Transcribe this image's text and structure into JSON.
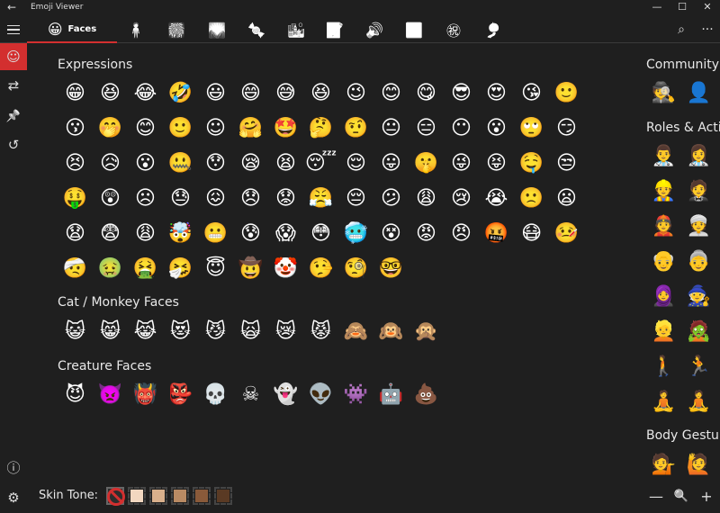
{
  "titlebar": {
    "back_icon": "←",
    "title": "Emoji Viewer",
    "minimize": "—",
    "maximize": "☐",
    "close": "✕"
  },
  "tabs": [
    {
      "name": "faces",
      "icon": "😀",
      "label": "Faces",
      "active": true
    },
    {
      "name": "people",
      "icon": "🧍",
      "label": ""
    },
    {
      "name": "activities",
      "icon": "🎆",
      "label": ""
    },
    {
      "name": "travel",
      "icon": "🌄",
      "label": ""
    },
    {
      "name": "food",
      "icon": "🍬",
      "label": ""
    },
    {
      "name": "places",
      "icon": "🏙",
      "label": ""
    },
    {
      "name": "objects",
      "icon": "📝",
      "label": ""
    },
    {
      "name": "sound",
      "icon": "🔊",
      "label": ""
    },
    {
      "name": "symbols",
      "icon": "🈺",
      "label": ""
    },
    {
      "name": "flags",
      "icon": "㊗",
      "label": ""
    },
    {
      "name": "misc",
      "icon": "🎐",
      "label": ""
    }
  ],
  "toolbar": {
    "search_icon": "⌕",
    "more_icon": "···"
  },
  "leftnav": {
    "menu": "☰",
    "smiley": "☺",
    "convert": "⇄",
    "pin": "📌",
    "history": "↺",
    "info": "ⓘ",
    "settings": "⚙"
  },
  "sections": {
    "expressions": {
      "title": "Expressions",
      "emojis": [
        "😁",
        "😆",
        "😂",
        "🤣",
        "😃",
        "😄",
        "😅",
        "😆",
        "😉",
        "😊",
        "😋",
        "😎",
        "😍",
        "😘",
        "🙂",
        "😗",
        "🤭",
        "😊",
        "🙂",
        "☺",
        "🤗",
        "🤩",
        "🤔",
        "🤨",
        "😐",
        "😑",
        "😶",
        "😮",
        "🙄",
        "😏",
        "😣",
        "😥",
        "😮",
        "🤐",
        "😯",
        "😪",
        "😫",
        "😴",
        "😌",
        "😛",
        "🤫",
        "😜",
        "😝",
        "🤤",
        "😒",
        "🤑",
        "😲",
        "☹",
        "😓",
        "😖",
        "😞",
        "😟",
        "😤",
        "😔",
        "😕",
        "😩",
        "😢",
        "😭",
        "🙁",
        "😦",
        "😧",
        "😨",
        "😩",
        "🤯",
        "😬",
        "😰",
        "😱",
        "😳",
        "🥶",
        "😵",
        "😡",
        "😠",
        "🤬",
        "😷",
        "🤒",
        "🤕",
        "🤢",
        "🤮",
        "🤧",
        "😇",
        "🤠",
        "🤡",
        "🤥",
        "🧐",
        "🤓"
      ]
    },
    "cats": {
      "title": "Cat / Monkey Faces",
      "emojis": [
        "😺",
        "😸",
        "😹",
        "😻",
        "😼",
        "🙀",
        "😿",
        "😾",
        "🙈",
        "🙉",
        "🙊"
      ]
    },
    "creatures": {
      "title": "Creature Faces",
      "emojis": [
        "😈",
        "👿",
        "👹",
        "👺",
        "💀",
        "☠",
        "👻",
        "👽",
        "👾",
        "🤖",
        "💩"
      ]
    }
  },
  "right_panel": {
    "community": {
      "title": "Community",
      "emojis": [
        "🕵",
        "👤"
      ]
    },
    "roles": {
      "title": "Roles & Activities",
      "emojis": [
        "👨‍⚕️",
        "👩‍⚕️",
        "👷",
        "🤵",
        "👲",
        "👳",
        "👴",
        "👵",
        "🧕",
        "🧙",
        "👱",
        "🧟",
        "🚶",
        "🏃",
        "🧘",
        "🧘"
      ]
    },
    "gestures": {
      "title": "Body Gestures",
      "emojis": [
        "💁",
        "🙋"
      ]
    },
    "zoom_out": "—",
    "zoom_icon": "🔍",
    "zoom_in": "+"
  },
  "footer": {
    "skin_tone_label": "Skin Tone:",
    "tones": [
      "none",
      "#f2d7c0",
      "#d9b08c",
      "#b98a63",
      "#8a5a3a",
      "#5a3a24"
    ],
    "selected": "none"
  }
}
